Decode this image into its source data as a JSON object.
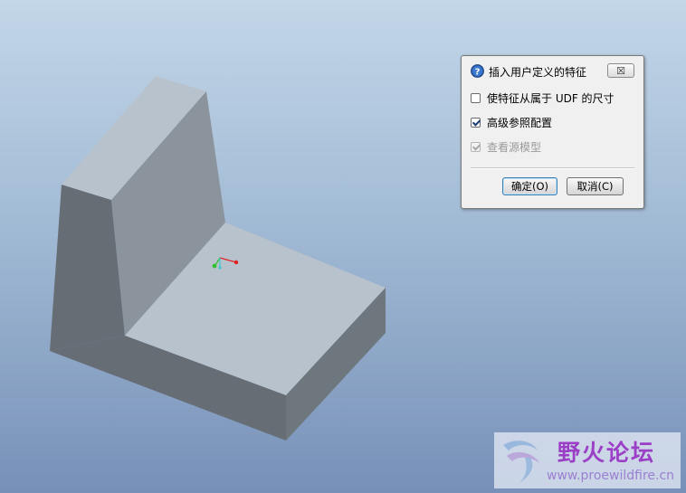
{
  "dialog": {
    "title": "插入用户定义的特征",
    "close_label": "☒",
    "options": [
      {
        "label": "使特征从属于 UDF 的尺寸",
        "checked": false,
        "enabled": true
      },
      {
        "label": "高级参照配置",
        "checked": true,
        "enabled": true
      },
      {
        "label": "查看源模型",
        "checked": true,
        "enabled": false
      }
    ],
    "ok_label": "确定(O)",
    "cancel_label": "取消(C)"
  },
  "watermark": {
    "title": "野火论坛",
    "url": "www.proewildfire.cn"
  },
  "colors": {
    "background_top": "#c3d6e8",
    "background_bottom": "#7790b8",
    "model_top_face": "#b8c2cc",
    "model_side_face": "#8b949d",
    "model_front_face": "#666d75",
    "watermark_text": "#9b3fc6"
  },
  "icons": {
    "dialog_title_icon": "help-question-icon",
    "csys_marker": "coordinate-system-icon",
    "watermark_logo": "forum-logo-icon"
  }
}
